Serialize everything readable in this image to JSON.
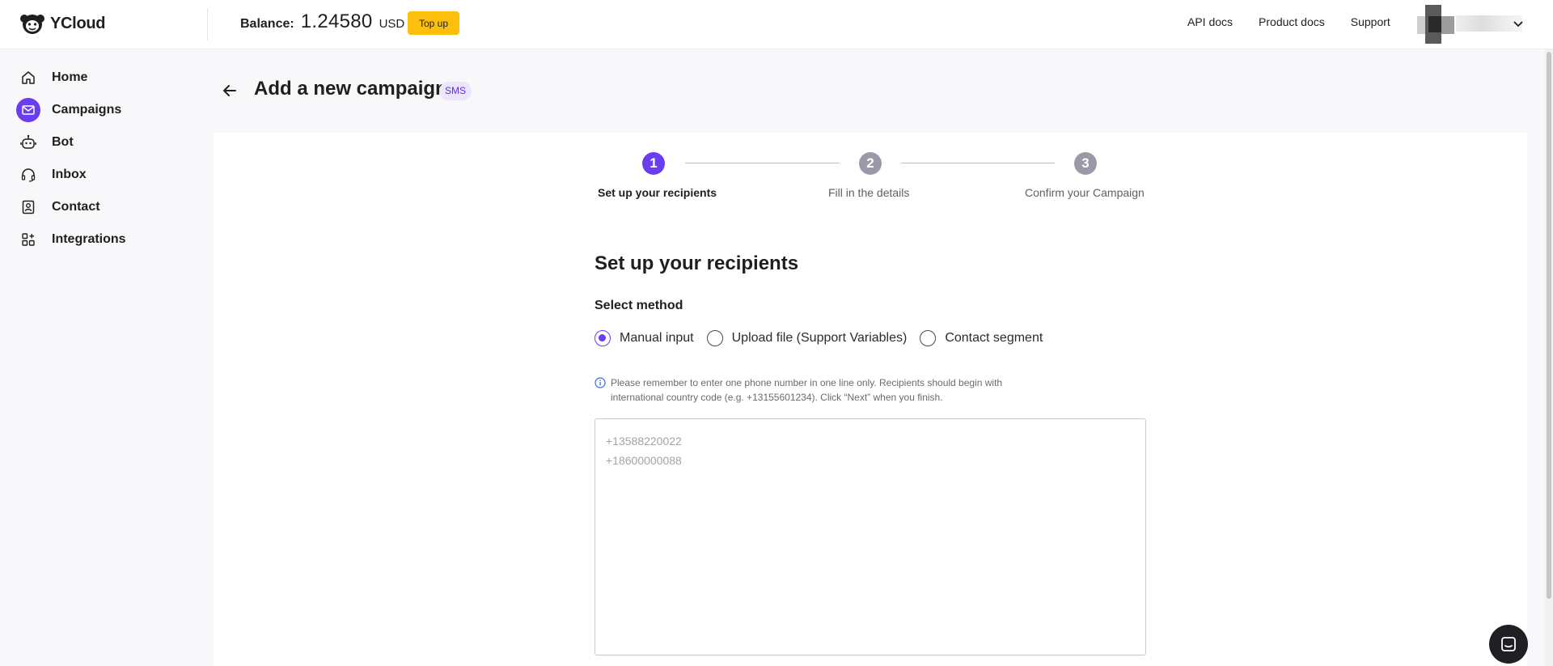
{
  "app": {
    "name": "YCloud"
  },
  "header": {
    "balance_label": "Balance:",
    "balance_value": "1.24580",
    "balance_currency": "USD",
    "topup_label": "Top up",
    "nav": [
      {
        "label": "API docs"
      },
      {
        "label": "Product docs"
      },
      {
        "label": "Support"
      }
    ]
  },
  "sidebar": {
    "items": [
      {
        "label": "Home",
        "icon": "home-icon"
      },
      {
        "label": "Campaigns",
        "icon": "campaigns-icon",
        "active": true
      },
      {
        "label": "Bot",
        "icon": "bot-icon"
      },
      {
        "label": "Inbox",
        "icon": "headset-icon"
      },
      {
        "label": "Contact",
        "icon": "contact-icon"
      },
      {
        "label": "Integrations",
        "icon": "integrations-icon"
      }
    ]
  },
  "page": {
    "title": "Add a new campaign",
    "badge": "SMS"
  },
  "stepper": {
    "steps": [
      {
        "number": "1",
        "label": "Set up your recipients",
        "active": true
      },
      {
        "number": "2",
        "label": "Fill in the details",
        "active": false
      },
      {
        "number": "3",
        "label": "Confirm your Campaign",
        "active": false
      }
    ]
  },
  "form": {
    "section_title": "Set up your recipients",
    "method_label": "Select method",
    "methods": [
      {
        "label": "Manual input",
        "checked": true
      },
      {
        "label": "Upload file (Support Variables)",
        "checked": false
      },
      {
        "label": "Contact segment",
        "checked": false
      }
    ],
    "hint": "Please remember to enter one phone number in one line only. Recipients should begin with international country code (e.g. +13155601234). Click “Next” when you finish.",
    "recipients_value": "",
    "recipients_placeholder": "+13588220022\n+18600000088"
  },
  "colors": {
    "accent": "#6b3df0",
    "topup": "#fbbf0c",
    "badge_bg": "#ece6fd",
    "step_inactive": "#9d98a8"
  }
}
